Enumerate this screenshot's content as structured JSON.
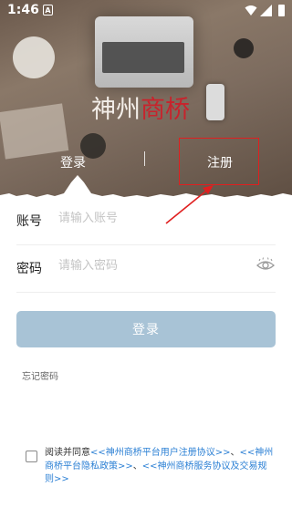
{
  "status_bar": {
    "time": "1:46",
    "notification_icon": "A"
  },
  "brand": {
    "logo_part1": "神州",
    "logo_part2": "商桥",
    "logo_accent_color": "#c8232c"
  },
  "tabs": {
    "login": "登录",
    "register": "注册"
  },
  "form": {
    "account_label": "账号",
    "account_placeholder": "请输入账号",
    "password_label": "密码",
    "password_placeholder": "请输入密码",
    "login_button": "登录",
    "forgot_password": "忘记密码"
  },
  "agreement": {
    "prefix": "阅读并同意",
    "link1": "<<神州商桥平台用户注册协议>>",
    "sep1": "、",
    "link2": "<<神州商桥平台隐私政策>>",
    "sep2": "、",
    "link3": "<<神州商桥服务协议及交易规则>>"
  },
  "colors": {
    "button_bg": "#a8c3d6",
    "link": "#2a7fd4",
    "annotation": "#e01f1f"
  }
}
